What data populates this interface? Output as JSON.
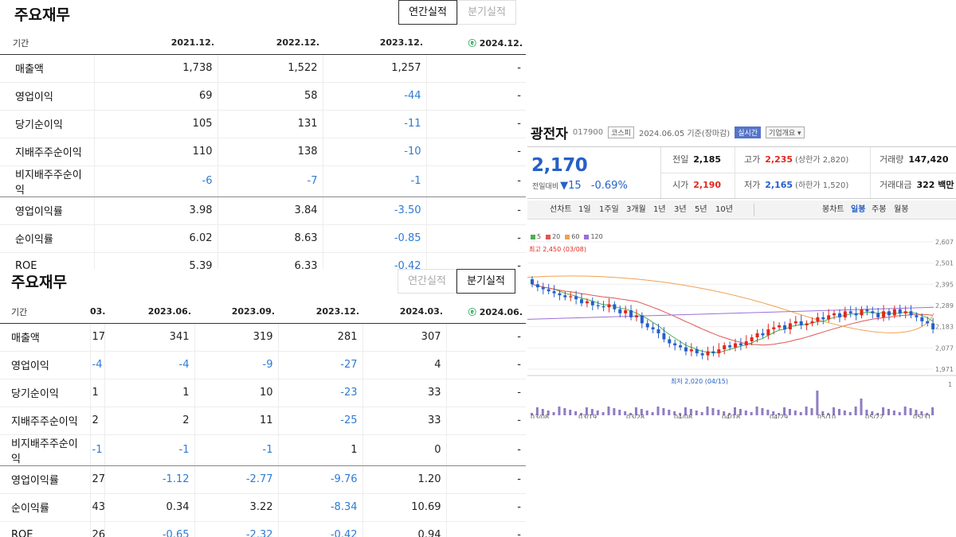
{
  "annual": {
    "title": "주요재무",
    "tabs": [
      "연간실적",
      "분기실적"
    ],
    "active_tab": 0,
    "label_header": "기간",
    "estimate_mark": "ⓔ",
    "columns": [
      "2021.12.",
      "2022.12.",
      "2023.12.",
      "2024.12."
    ],
    "rows": [
      {
        "label": "매출액",
        "values": [
          "1,738",
          "1,522",
          "1,257",
          "-"
        ],
        "sep": false
      },
      {
        "label": "영업이익",
        "values": [
          "69",
          "58",
          "-44",
          "-"
        ],
        "sep": false
      },
      {
        "label": "당기순이익",
        "values": [
          "105",
          "131",
          "-11",
          "-"
        ],
        "sep": false
      },
      {
        "label": "지배주주순이익",
        "values": [
          "110",
          "138",
          "-10",
          "-"
        ],
        "sep": false
      },
      {
        "label": "비지배주주순이익",
        "values": [
          "-6",
          "-7",
          "-1",
          "-"
        ],
        "sep": true
      },
      {
        "label": "영업이익률",
        "values": [
          "3.98",
          "3.84",
          "-3.50",
          "-"
        ],
        "sep": false
      },
      {
        "label": "순이익률",
        "values": [
          "6.02",
          "8.63",
          "-0.85",
          "-"
        ],
        "sep": false
      },
      {
        "label": "ROE",
        "values": [
          "5.39",
          "6.33",
          "-0.42",
          "-"
        ],
        "sep": false
      }
    ]
  },
  "quarter": {
    "title": "주요재무",
    "tabs": [
      "연간실적",
      "분기실적"
    ],
    "active_tab": 1,
    "label_header": "기간",
    "estimate_mark": "ⓔ",
    "cut_column": "03.",
    "columns": [
      "2023.06.",
      "2023.09.",
      "2023.12.",
      "2024.03.",
      "2024.06."
    ],
    "rows": [
      {
        "label": "매출액",
        "cut": "17",
        "values": [
          "341",
          "319",
          "281",
          "307",
          "-"
        ],
        "sep": false
      },
      {
        "label": "영업이익",
        "cut": "-4",
        "values": [
          "-4",
          "-9",
          "-27",
          "4",
          "-"
        ],
        "sep": false
      },
      {
        "label": "당기순이익",
        "cut": "1",
        "values": [
          "1",
          "10",
          "-23",
          "33",
          "-"
        ],
        "sep": false
      },
      {
        "label": "지배주주순이익",
        "cut": "2",
        "values": [
          "2",
          "11",
          "-25",
          "33",
          "-"
        ],
        "sep": false
      },
      {
        "label": "비지배주주순이익",
        "cut": "-1",
        "values": [
          "-1",
          "-1",
          "1",
          "0",
          "-"
        ],
        "sep": true
      },
      {
        "label": "영업이익률",
        "cut": "27",
        "values": [
          "-1.12",
          "-2.77",
          "-9.76",
          "1.20",
          "-"
        ],
        "sep": false
      },
      {
        "label": "순이익률",
        "cut": "43",
        "values": [
          "0.34",
          "3.22",
          "-8.34",
          "10.69",
          "-"
        ],
        "sep": false
      },
      {
        "label": "ROE",
        "cut": "26",
        "values": [
          "-0.65",
          "-2.32",
          "-0.42",
          "0.94",
          "-"
        ],
        "sep": false
      }
    ]
  },
  "stock": {
    "name": "광전자",
    "code": "017900",
    "market": "코스피",
    "date_note": "2024.06.05 기준(장마감)",
    "realtime_label": "실시간",
    "company_info_label": "기업개요",
    "price": "2,170",
    "change_label": "전일대비",
    "change_arrow": "▼",
    "change_value": "15",
    "change_pct": "-0.69%",
    "quote": {
      "prev_close": {
        "k": "전일",
        "v": "2,185"
      },
      "high": {
        "k": "고가",
        "v": "2,235",
        "sub": "(상한가 2,820)"
      },
      "volume": {
        "k": "거래량",
        "v": "147,420"
      },
      "open": {
        "k": "시가",
        "v": "2,190"
      },
      "low": {
        "k": "저가",
        "v": "2,165",
        "sub": "(하한가 1,520)"
      },
      "amount": {
        "k": "거래대금",
        "v": "322 백만"
      }
    },
    "ranges": [
      "선차트",
      "1일",
      "1주일",
      "3개월",
      "1년",
      "3년",
      "5년",
      "10년"
    ],
    "candle_modes": [
      "봉차트",
      "일봉",
      "주봉",
      "월봉"
    ],
    "active_candle_mode": 1,
    "legend": [
      {
        "label": "5",
        "color": "#4caf50"
      },
      {
        "label": "20",
        "color": "#e05555"
      },
      {
        "label": "60",
        "color": "#f0a050"
      },
      {
        "label": "120",
        "color": "#9b6fd8"
      }
    ],
    "max_label": "최고 2,450 (03/08)",
    "min_label": "최저 2,020 (04/15)",
    "y_ticks": [
      "2,607",
      "2,501",
      "2,395",
      "2,289",
      "2,183",
      "2,077",
      "1,971"
    ],
    "x_ticks": [
      "03/08",
      "03/19",
      "03/28",
      "04/08",
      "04/18",
      "04/29",
      "05/10",
      "05/22",
      "05/31"
    ],
    "volume_axis_label": "1"
  }
}
